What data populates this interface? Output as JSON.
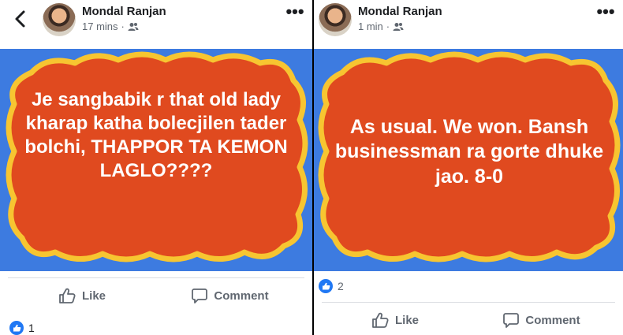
{
  "posts": [
    {
      "author": "Mondal Ranjan",
      "time": "17 mins",
      "separator": "·",
      "text": "Je sangbabik r that old lady kharap katha bolecjilen tader bolchi, THAPPOR TA KEMON LAGLO????",
      "reaction_count": "1",
      "like_label": "Like",
      "comment_label": "Comment"
    },
    {
      "author": "Mondal Ranjan",
      "time": "1 min",
      "separator": "·",
      "text": "As usual. We won. Bansh businessman ra gorte dhuke jao. 8-0",
      "reaction_count": "2",
      "like_label": "Like",
      "comment_label": "Comment"
    }
  ],
  "colors": {
    "image_background": "#3d7be0",
    "bubble_fill": "#e04a1f",
    "bubble_border": "#f7c531",
    "facebook_blue": "#2078f4"
  },
  "icons": [
    "back-arrow-icon",
    "avatar",
    "friends-icon",
    "more-options-icon",
    "thumbs-up-icon",
    "comment-icon",
    "like-reaction-icon"
  ]
}
